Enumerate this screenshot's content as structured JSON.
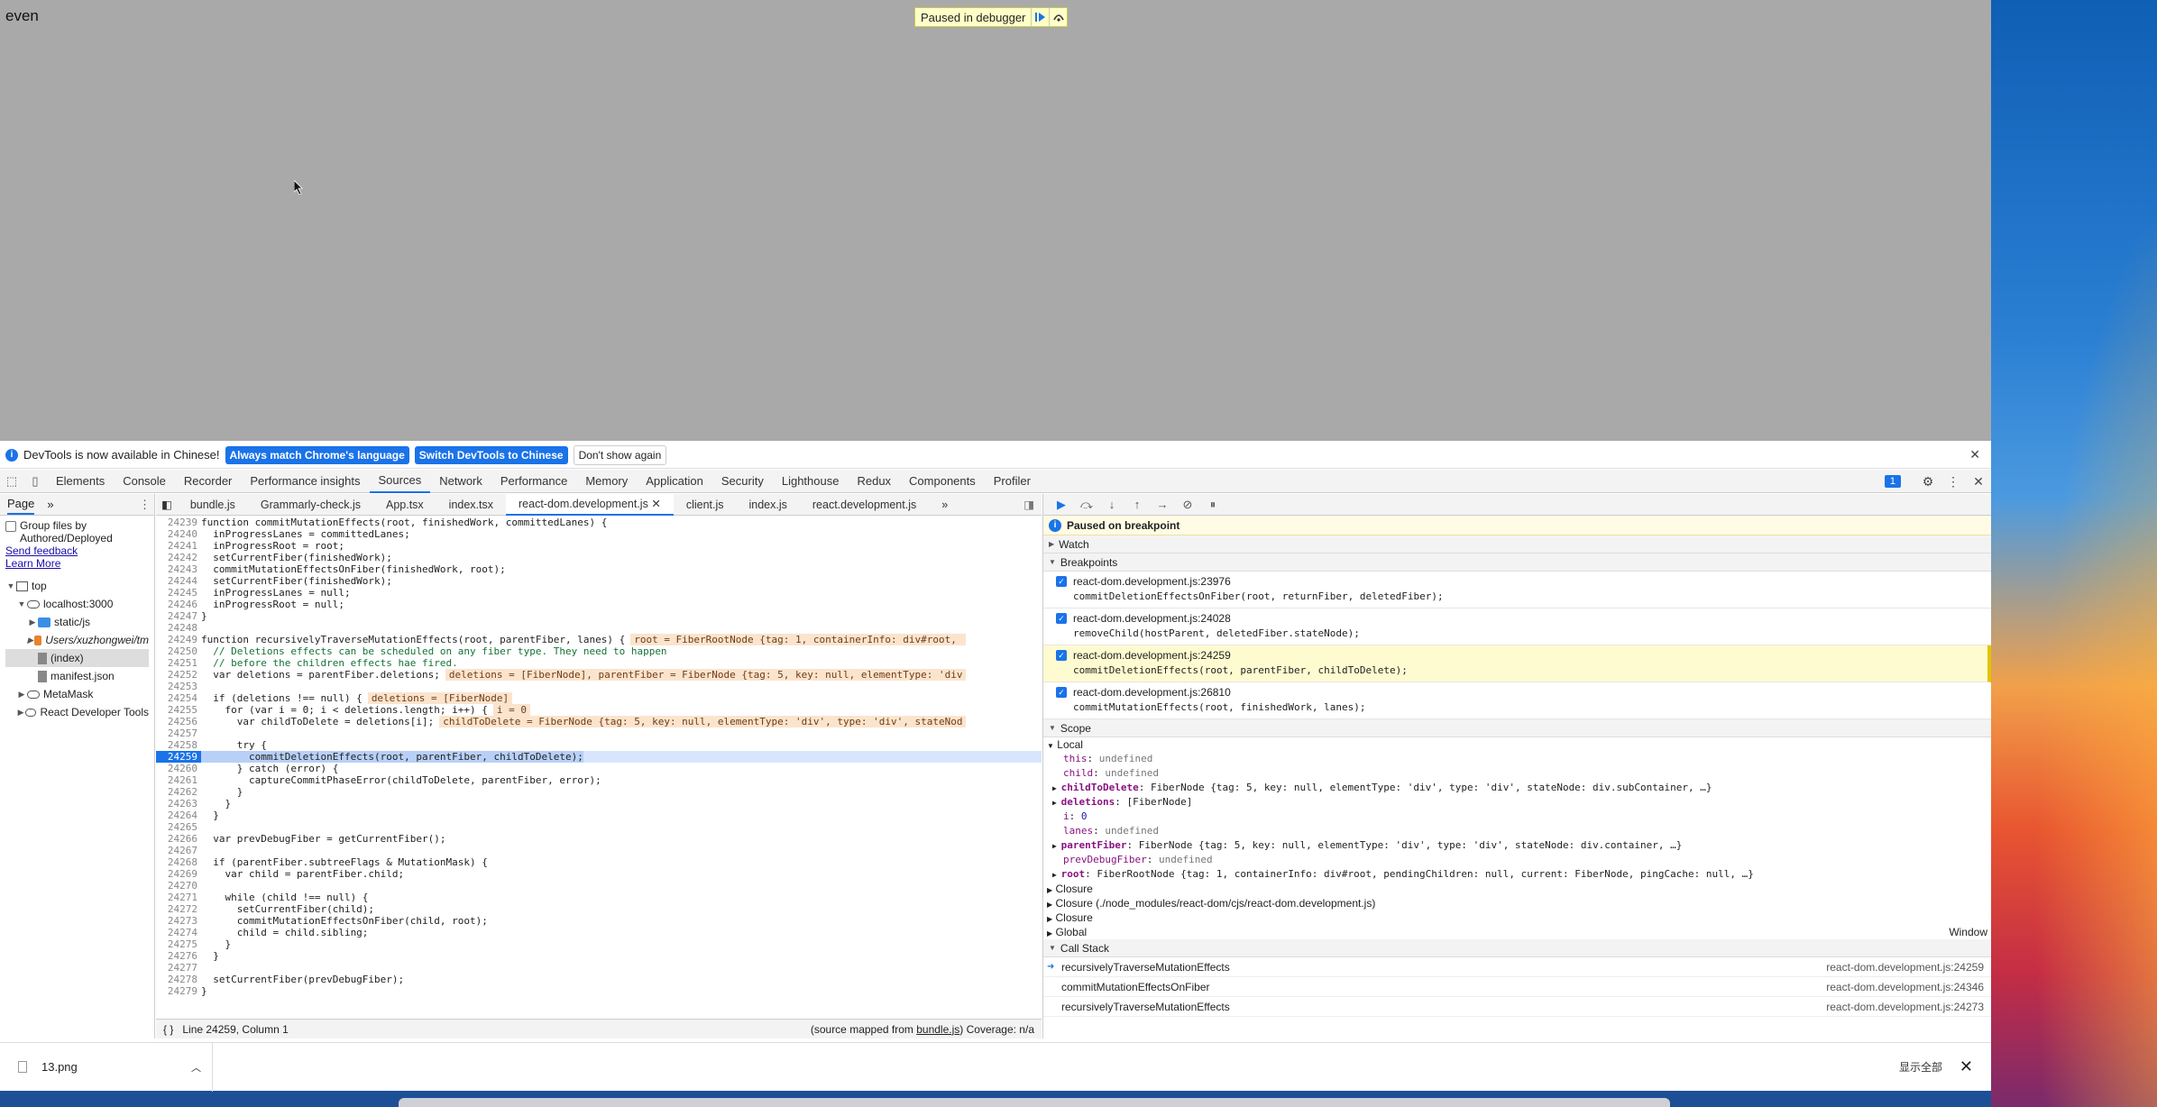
{
  "page": {
    "text": "even",
    "paused_label": "Paused in debugger"
  },
  "infobar": {
    "message": "DevTools is now available in Chinese!",
    "btn_match": "Always match Chrome's language",
    "btn_switch": "Switch DevTools to Chinese",
    "btn_dismiss": "Don't show again"
  },
  "tabs": [
    "Elements",
    "Console",
    "Recorder",
    "Performance insights",
    "Sources",
    "Network",
    "Performance",
    "Memory",
    "Application",
    "Security",
    "Lighthouse",
    "Redux",
    "Components",
    "Profiler"
  ],
  "selected_tab": "Sources",
  "messages_count": "1",
  "navigator": {
    "tab": "Page",
    "group_label": "Group files by Authored/Deployed",
    "feedback": "Send feedback",
    "learn": "Learn More",
    "tree": [
      {
        "label": "top"
      },
      {
        "label": "localhost:3000"
      },
      {
        "label": "static/js"
      },
      {
        "label": "Users/xuzhongwei/tm"
      },
      {
        "label": "(index)"
      },
      {
        "label": "manifest.json"
      },
      {
        "label": "MetaMask"
      },
      {
        "label": "React Developer Tools"
      }
    ]
  },
  "file_tabs": [
    "bundle.js",
    "Grammarly-check.js",
    "App.tsx",
    "index.tsx",
    "react-dom.development.js",
    "client.js",
    "index.js",
    "react.development.js"
  ],
  "code": [
    {
      "n": "24239",
      "t": "function commitMutationEffects(root, finishedWork, committedLanes) {"
    },
    {
      "n": "24240",
      "t": "  inProgressLanes = committedLanes;"
    },
    {
      "n": "24241",
      "t": "  inProgressRoot = root;"
    },
    {
      "n": "24242",
      "t": "  setCurrentFiber(finishedWork);"
    },
    {
      "n": "24243",
      "t": "  commitMutationEffectsOnFiber(finishedWork, root);"
    },
    {
      "n": "24244",
      "t": "  setCurrentFiber(finishedWork);"
    },
    {
      "n": "24245",
      "t": "  inProgressLanes = null;"
    },
    {
      "n": "24246",
      "t": "  inProgressRoot = null;"
    },
    {
      "n": "24247",
      "t": "}"
    },
    {
      "n": "24248",
      "t": ""
    },
    {
      "n": "24249",
      "t": "function recursivelyTraverseMutationEffects(root, parentFiber, lanes) {",
      "inl": "root = FiberRootNode {tag: 1, containerInfo: div#root, "
    },
    {
      "n": "24250",
      "t": "  // Deletions effects can be scheduled on any fiber type. They need to happen",
      "cm": true
    },
    {
      "n": "24251",
      "t": "  // before the children effects hae fired.",
      "cm": true
    },
    {
      "n": "24252",
      "t": "  var deletions = parentFiber.deletions;",
      "inl": "deletions = [FiberNode], parentFiber = FiberNode {tag: 5, key: null, elementType: 'div"
    },
    {
      "n": "24253",
      "t": ""
    },
    {
      "n": "24254",
      "t": "  if (deletions !== null) {",
      "inl": "deletions = [FiberNode]"
    },
    {
      "n": "24255",
      "t": "    for (var i = 0; i < deletions.length; i++) {",
      "inl": "i = 0"
    },
    {
      "n": "24256",
      "t": "      var childToDelete = deletions[i];",
      "inl": "childToDelete = FiberNode {tag: 5, key: null, elementType: 'div', type: 'div', stateNod"
    },
    {
      "n": "24257",
      "t": ""
    },
    {
      "n": "24258",
      "t": "      try {"
    },
    {
      "n": "24259",
      "t": "        commitDeletionEffects(root, parentFiber, childToDelete);",
      "cur": true
    },
    {
      "n": "24260",
      "t": "      } catch (error) {"
    },
    {
      "n": "24261",
      "t": "        captureCommitPhaseError(childToDelete, parentFiber, error);"
    },
    {
      "n": "24262",
      "t": "      }"
    },
    {
      "n": "24263",
      "t": "    }"
    },
    {
      "n": "24264",
      "t": "  }"
    },
    {
      "n": "24265",
      "t": ""
    },
    {
      "n": "24266",
      "t": "  var prevDebugFiber = getCurrentFiber();"
    },
    {
      "n": "24267",
      "t": ""
    },
    {
      "n": "24268",
      "t": "  if (parentFiber.subtreeFlags & MutationMask) {"
    },
    {
      "n": "24269",
      "t": "    var child = parentFiber.child;"
    },
    {
      "n": "24270",
      "t": ""
    },
    {
      "n": "24271",
      "t": "    while (child !== null) {"
    },
    {
      "n": "24272",
      "t": "      setCurrentFiber(child);"
    },
    {
      "n": "24273",
      "t": "      commitMutationEffectsOnFiber(child, root);"
    },
    {
      "n": "24274",
      "t": "      child = child.sibling;"
    },
    {
      "n": "24275",
      "t": "    }"
    },
    {
      "n": "24276",
      "t": "  }"
    },
    {
      "n": "24277",
      "t": ""
    },
    {
      "n": "24278",
      "t": "  setCurrentFiber(prevDebugFiber);"
    },
    {
      "n": "24279",
      "t": "}"
    }
  ],
  "statusbar": {
    "pos": "Line 24259, Column 1",
    "mapped": "(source mapped from ",
    "mapped_file": "bundle.js",
    "coverage": ") Coverage: n/a"
  },
  "debugger": {
    "paused": "Paused on breakpoint",
    "watch": "Watch",
    "breakpoints_title": "Breakpoints",
    "breakpoints": [
      {
        "file": "react-dom.development.js:23976",
        "code": "commitDeletionEffectsOnFiber(root, returnFiber, deletedFiber);"
      },
      {
        "file": "react-dom.development.js:24028",
        "code": "removeChild(hostParent, deletedFiber.stateNode);"
      },
      {
        "file": "react-dom.development.js:24259",
        "code": "commitDeletionEffects(root, parentFiber, childToDelete);",
        "hi": true
      },
      {
        "file": "react-dom.development.js:26810",
        "code": "commitMutationEffects(root, finishedWork, lanes);"
      }
    ],
    "scope_title": "Scope",
    "local": "Local",
    "scope": [
      {
        "k": "this",
        "v": "undefined"
      },
      {
        "k": "child",
        "v": "undefined"
      },
      {
        "k": "childToDelete",
        "v": "FiberNode {tag: 5, key: null, elementType: 'div', type: 'div', stateNode: div.subContainer, …}",
        "exp": true
      },
      {
        "k": "deletions",
        "v": "[FiberNode]",
        "exp": true
      },
      {
        "k": "i",
        "v": "0"
      },
      {
        "k": "lanes",
        "v": "undefined"
      },
      {
        "k": "parentFiber",
        "v": "FiberNode {tag: 5, key: null, elementType: 'div', type: 'div', stateNode: div.container, …}",
        "exp": true
      },
      {
        "k": "prevDebugFiber",
        "v": "undefined"
      },
      {
        "k": "root",
        "v": "FiberRootNode {tag: 1, containerInfo: div#root, pendingChildren: null, current: FiberNode, pingCache: null, …}",
        "exp": true
      }
    ],
    "closures": [
      "Closure",
      "Closure (./node_modules/react-dom/cjs/react-dom.development.js)",
      "Closure"
    ],
    "global": "Global",
    "global_val": "Window",
    "callstack_title": "Call Stack",
    "callstack": [
      {
        "fn": "recursivelyTraverseMutationEffects",
        "loc": "react-dom.development.js:24259"
      },
      {
        "fn": "commitMutationEffectsOnFiber",
        "loc": "react-dom.development.js:24346"
      },
      {
        "fn": "recursivelyTraverseMutationEffects",
        "loc": "react-dom.development.js:24273"
      }
    ]
  },
  "downloads": {
    "file": "13.png",
    "show_all": "显示全部"
  }
}
